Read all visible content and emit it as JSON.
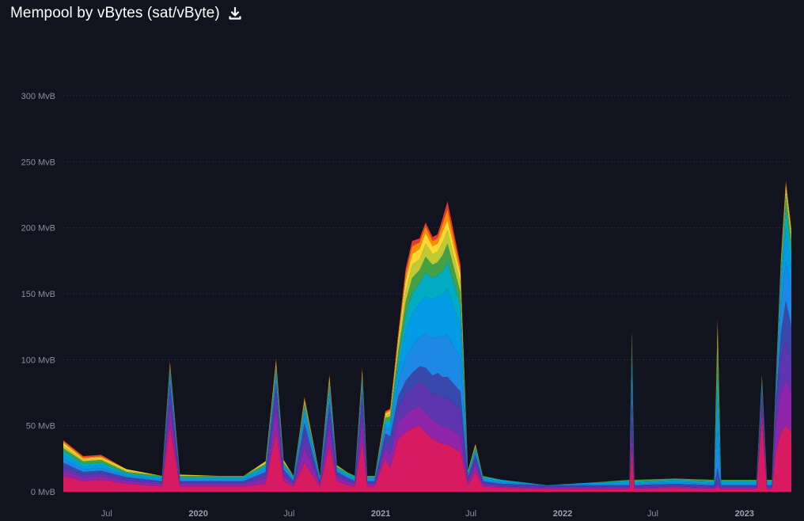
{
  "header": {
    "title": "Mempool by vBytes (sat/vByte)",
    "download_icon": "download-icon"
  },
  "chart_data": {
    "type": "area",
    "stacked": true,
    "title": "Mempool by vBytes (sat/vByte)",
    "xlabel": "",
    "ylabel": "",
    "ylim": [
      0,
      300
    ],
    "y_ticks": [
      {
        "value": 0,
        "label": "0 MvB"
      },
      {
        "value": 50,
        "label": "50 MvB"
      },
      {
        "value": 100,
        "label": "100 MvB"
      },
      {
        "value": 150,
        "label": "150 MvB"
      },
      {
        "value": 200,
        "label": "200 MvB"
      },
      {
        "value": 250,
        "label": "250 MvB"
      },
      {
        "value": 300,
        "label": "300 MvB"
      }
    ],
    "x_range": [
      "2019-04-05",
      "2023-04-05"
    ],
    "x_ticks": [
      {
        "date": "2019-07-01",
        "label": "Jul",
        "bold": false
      },
      {
        "date": "2020-01-01",
        "label": "2020",
        "bold": true
      },
      {
        "date": "2020-07-01",
        "label": "Jul",
        "bold": false
      },
      {
        "date": "2021-01-01",
        "label": "2021",
        "bold": true
      },
      {
        "date": "2021-07-01",
        "label": "Jul",
        "bold": false
      },
      {
        "date": "2022-01-01",
        "label": "2022",
        "bold": true
      },
      {
        "date": "2022-07-01",
        "label": "Jul",
        "bold": false
      },
      {
        "date": "2023-01-01",
        "label": "2023",
        "bold": true
      }
    ],
    "grid": true,
    "legend": "none",
    "series_colors": [
      "#d81b60",
      "#8e24aa",
      "#5e35b1",
      "#3949ab",
      "#1e88e5",
      "#039be5",
      "#00acc1",
      "#43a047",
      "#c0ca33",
      "#fdd835",
      "#fb8c00",
      "#e53935"
    ],
    "x": [
      "2019-04-05",
      "2019-05-15",
      "2019-06-20",
      "2019-08-10",
      "2019-10-20",
      "2019-11-05",
      "2019-11-25",
      "2020-02-10",
      "2020-04-01",
      "2020-05-15",
      "2020-06-05",
      "2020-06-20",
      "2020-07-10",
      "2020-08-01",
      "2020-09-01",
      "2020-09-20",
      "2020-10-05",
      "2020-10-25",
      "2020-11-10",
      "2020-11-25",
      "2020-12-05",
      "2020-12-20",
      "2021-01-10",
      "2021-01-20",
      "2021-02-05",
      "2021-02-20",
      "2021-03-05",
      "2021-03-20",
      "2021-04-01",
      "2021-04-15",
      "2021-04-25",
      "2021-05-05",
      "2021-05-15",
      "2021-06-10",
      "2021-06-25",
      "2021-07-10",
      "2021-07-25",
      "2021-09-01",
      "2021-12-01",
      "2022-03-01",
      "2022-05-15",
      "2022-05-20",
      "2022-05-25",
      "2022-08-15",
      "2022-11-01",
      "2022-11-08",
      "2022-11-15",
      "2022-12-20",
      "2023-01-25",
      "2023-02-05",
      "2023-02-15",
      "2023-02-25",
      "2023-03-05",
      "2023-03-15",
      "2023-03-25",
      "2023-04-05"
    ],
    "series": [
      {
        "values": [
          12,
          8,
          9,
          6,
          4,
          50,
          4,
          4,
          4,
          6,
          45,
          8,
          4,
          22,
          4,
          35,
          8,
          5,
          4,
          38,
          4,
          4,
          25,
          18,
          40,
          45,
          48,
          50,
          45,
          40,
          38,
          36,
          36,
          30,
          5,
          15,
          4,
          3,
          2,
          2,
          2,
          35,
          2,
          3,
          2,
          4,
          2,
          2,
          2,
          55,
          2,
          2,
          30,
          45,
          50,
          45
        ]
      },
      {
        "values": [
          4,
          3,
          3,
          2,
          2,
          15,
          2,
          2,
          2,
          4,
          18,
          4,
          2,
          12,
          2,
          15,
          3,
          3,
          2,
          18,
          2,
          2,
          8,
          10,
          12,
          14,
          14,
          15,
          15,
          14,
          14,
          13,
          13,
          12,
          3,
          6,
          2,
          1,
          1,
          1,
          1,
          15,
          1,
          1,
          1,
          2,
          1,
          1,
          1,
          10,
          1,
          1,
          20,
          30,
          35,
          30
        ]
      },
      {
        "values": [
          3,
          2,
          2,
          2,
          1,
          10,
          1,
          1,
          1,
          3,
          12,
          3,
          1,
          10,
          1,
          10,
          2,
          2,
          1,
          12,
          1,
          1,
          6,
          8,
          12,
          15,
          16,
          18,
          20,
          20,
          22,
          22,
          22,
          20,
          2,
          4,
          1,
          1,
          1,
          1,
          1,
          15,
          1,
          1,
          1,
          2,
          1,
          1,
          1,
          8,
          1,
          1,
          15,
          25,
          30,
          25
        ]
      },
      {
        "values": [
          3,
          2,
          2,
          1,
          1,
          8,
          1,
          1,
          1,
          2,
          8,
          2,
          1,
          8,
          1,
          8,
          2,
          1,
          1,
          8,
          1,
          1,
          5,
          6,
          8,
          10,
          12,
          12,
          14,
          14,
          16,
          16,
          16,
          14,
          1,
          3,
          1,
          1,
          1,
          1,
          1,
          15,
          1,
          1,
          1,
          10,
          1,
          1,
          1,
          5,
          1,
          1,
          5,
          20,
          30,
          25
        ]
      },
      {
        "values": [
          3,
          2,
          2,
          1,
          1,
          5,
          1,
          1,
          1,
          2,
          5,
          2,
          1,
          6,
          1,
          6,
          1,
          1,
          1,
          5,
          1,
          1,
          4,
          5,
          10,
          18,
          20,
          22,
          26,
          28,
          28,
          30,
          32,
          25,
          1,
          2,
          1,
          1,
          0,
          1,
          1,
          15,
          1,
          1,
          1,
          30,
          1,
          1,
          1,
          3,
          1,
          1,
          5,
          20,
          30,
          25
        ]
      },
      {
        "values": [
          3,
          2,
          2,
          1,
          1,
          3,
          1,
          1,
          1,
          2,
          3,
          1,
          1,
          4,
          1,
          4,
          1,
          1,
          1,
          3,
          1,
          1,
          3,
          4,
          10,
          20,
          25,
          26,
          28,
          30,
          30,
          32,
          35,
          25,
          1,
          2,
          1,
          1,
          0,
          1,
          1,
          10,
          1,
          1,
          1,
          25,
          1,
          1,
          1,
          2,
          1,
          1,
          3,
          15,
          25,
          20
        ]
      },
      {
        "values": [
          3,
          2,
          2,
          1,
          1,
          2,
          1,
          1,
          1,
          1,
          2,
          1,
          1,
          3,
          1,
          3,
          1,
          1,
          1,
          2,
          1,
          1,
          3,
          3,
          8,
          12,
          15,
          15,
          18,
          16,
          16,
          18,
          20,
          15,
          1,
          1,
          1,
          1,
          0,
          0,
          1,
          5,
          1,
          1,
          1,
          20,
          1,
          1,
          1,
          2,
          1,
          1,
          2,
          10,
          15,
          12
        ]
      },
      {
        "values": [
          2,
          2,
          2,
          1,
          1,
          2,
          1,
          1,
          1,
          1,
          2,
          1,
          1,
          2,
          1,
          2,
          1,
          1,
          1,
          2,
          1,
          1,
          2,
          3,
          6,
          10,
          12,
          10,
          12,
          10,
          10,
          12,
          14,
          10,
          1,
          1,
          1,
          0,
          0,
          0,
          1,
          5,
          1,
          1,
          1,
          20,
          1,
          1,
          1,
          1,
          1,
          1,
          2,
          5,
          10,
          8
        ]
      },
      {
        "values": [
          2,
          1,
          1,
          1,
          0,
          1,
          1,
          0,
          0,
          1,
          2,
          1,
          0,
          2,
          0,
          2,
          1,
          0,
          0,
          2,
          0,
          0,
          2,
          2,
          5,
          8,
          10,
          8,
          10,
          8,
          8,
          10,
          10,
          8,
          1,
          1,
          0,
          0,
          0,
          0,
          0,
          3,
          0,
          0,
          0,
          10,
          0,
          0,
          0,
          1,
          0,
          0,
          1,
          3,
          5,
          4
        ]
      },
      {
        "values": [
          2,
          1,
          1,
          1,
          0,
          1,
          0,
          0,
          0,
          1,
          2,
          1,
          0,
          1,
          0,
          2,
          0,
          0,
          0,
          2,
          0,
          0,
          1,
          2,
          4,
          8,
          8,
          8,
          8,
          6,
          6,
          8,
          8,
          6,
          0,
          1,
          0,
          0,
          0,
          0,
          0,
          2,
          0,
          0,
          0,
          5,
          0,
          0,
          0,
          1,
          0,
          0,
          1,
          2,
          3,
          3
        ]
      },
      {
        "values": [
          1,
          1,
          1,
          0,
          0,
          1,
          0,
          0,
          0,
          0,
          1,
          0,
          0,
          1,
          0,
          1,
          0,
          0,
          0,
          1,
          0,
          0,
          1,
          1,
          3,
          5,
          6,
          5,
          5,
          4,
          4,
          6,
          8,
          4,
          0,
          0,
          0,
          0,
          0,
          0,
          0,
          1,
          0,
          0,
          0,
          2,
          0,
          0,
          0,
          0,
          0,
          0,
          1,
          1,
          2,
          2
        ]
      },
      {
        "values": [
          1,
          1,
          1,
          0,
          0,
          1,
          0,
          0,
          0,
          0,
          1,
          0,
          0,
          1,
          0,
          1,
          0,
          0,
          0,
          1,
          0,
          0,
          1,
          1,
          2,
          4,
          4,
          3,
          3,
          3,
          3,
          4,
          6,
          3,
          0,
          0,
          0,
          0,
          0,
          0,
          0,
          1,
          0,
          0,
          0,
          1,
          0,
          0,
          0,
          0,
          0,
          0,
          0,
          1,
          1,
          1
        ]
      }
    ]
  }
}
